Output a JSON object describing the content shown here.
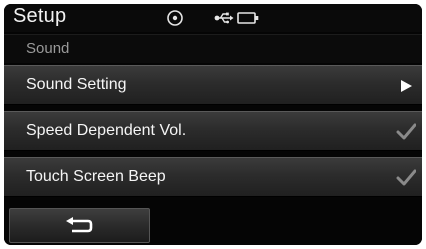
{
  "header": {
    "title": "Setup",
    "status_icons": [
      "disc-icon",
      "usb-icon",
      "battery-icon"
    ]
  },
  "section": {
    "title": "Sound"
  },
  "menu": {
    "items": [
      {
        "label": "Sound Setting",
        "control": "chevron-right-icon"
      },
      {
        "label": "Speed Dependent Vol.",
        "control": "checkmark-icon",
        "checked": true
      },
      {
        "label": "Touch Screen Beep",
        "control": "checkmark-icon",
        "checked": true
      }
    ]
  },
  "footer": {
    "back_button_icon": "back-arrow-icon"
  },
  "colors": {
    "background": "#050505",
    "text": "#f5f5f5",
    "subtitle": "#9a9a9a",
    "check": "#8a8a8a"
  }
}
